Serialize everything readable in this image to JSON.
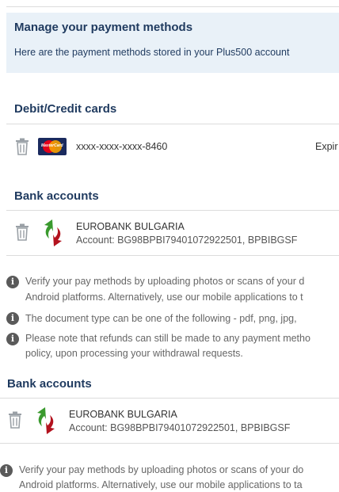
{
  "header": {
    "title": "Manage your payment methods",
    "subtitle": "Here are the payment methods stored in your Plus500 account"
  },
  "cards_section": {
    "title": "Debit/Credit cards",
    "card": {
      "brand_icon": "mastercard-icon",
      "brand_label": "MasterCard",
      "number": "xxxx-xxxx-xxxx-8460",
      "expiry_label": "Expir"
    }
  },
  "bank_section_1": {
    "title": "Bank accounts",
    "bank_name": "EUROBANK BULGARIA",
    "account": "Account: BG98BPBI79401072922501, BPBIBGSF"
  },
  "info_1": {
    "line1": "Verify your pay methods by uploading photos or scans of your d",
    "line2": "Android platforms. Alternatively, use our mobile applications to t",
    "line3": "The document type can be one of the following -  pdf, png, jpg,",
    "line4": "Please note that refunds can still be made to any payment metho",
    "line5": "policy, upon processing your withdrawal requests."
  },
  "bank_section_2": {
    "title": "Bank accounts",
    "bank_name": "EUROBANK BULGARIA",
    "account": "Account: BG98BPBI79401072922501, BPBIBGSF"
  },
  "info_2": {
    "line1": "Verify your pay methods by uploading photos or scans of your do",
    "line2": "Android platforms. Alternatively, use our mobile applications to ta"
  },
  "colors": {
    "heading": "#1f3a5f",
    "header_bg": "#e9f1f8",
    "bank_green": "#3a9a2e",
    "bank_red": "#b3121e"
  }
}
